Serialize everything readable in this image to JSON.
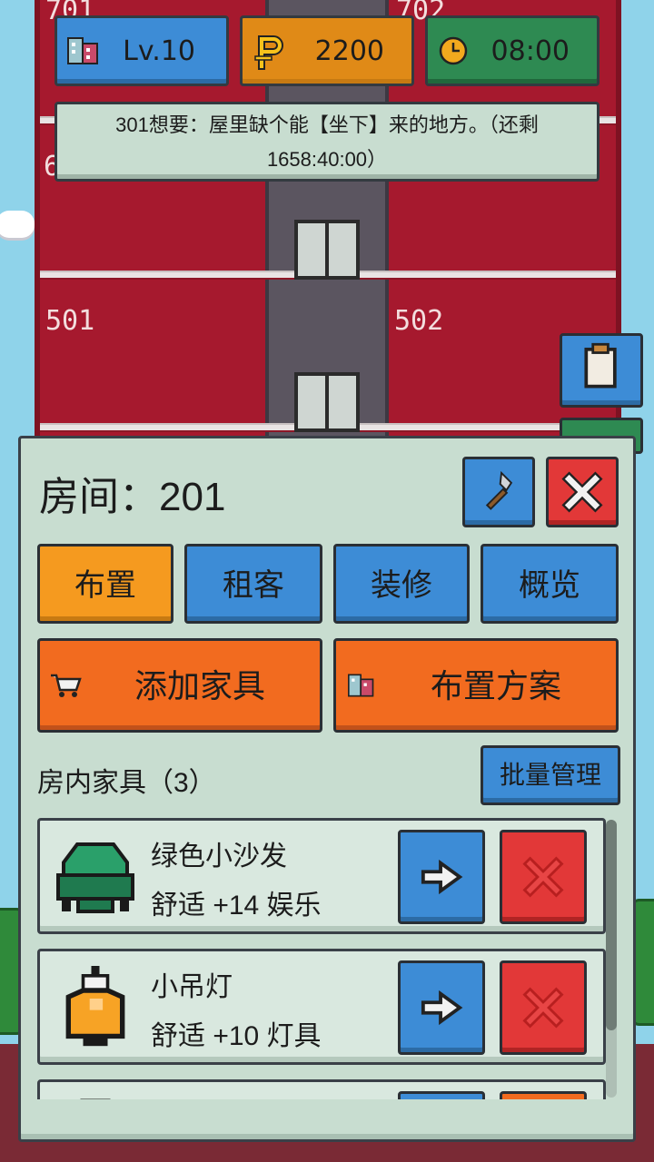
{
  "hud": {
    "level": "Lv.10",
    "coins": "2200",
    "time": "08:00",
    "icons": [
      "building-icon",
      "coin-icon",
      "clock-icon"
    ]
  },
  "quest": {
    "text": "301想要：屋里缺个能【坐下】来的地方。（还剩1658:40:00）"
  },
  "building": {
    "rooms": [
      "701",
      "702",
      "6",
      "501",
      "502"
    ]
  },
  "panel": {
    "title": "房间：201",
    "tabs": [
      "布置",
      "租客",
      "装修",
      "概览"
    ],
    "active_tab": "布置",
    "actions": {
      "add_furniture": "添加家具",
      "layout_plan": "布置方案"
    },
    "section_title": "房内家具（3）",
    "batch_label": "批量管理",
    "furniture": [
      {
        "name": "绿色小沙发",
        "stat": "舒适 +14 娱乐",
        "icon": "green-sofa-icon"
      },
      {
        "name": "小吊灯",
        "stat": "舒适 +10 灯具",
        "icon": "pendant-lamp-icon"
      },
      {
        "name": "",
        "stat": "",
        "icon": "furniture-icon"
      }
    ]
  },
  "colors": {
    "tower": "#a6192e",
    "panel": "#c8ddd0",
    "blue_button": "#3d8cd6",
    "red_button": "#e23838",
    "orange_tab": "#f59a1f",
    "orange_action": "#f26b1f",
    "green_hud": "#2e8a52"
  }
}
